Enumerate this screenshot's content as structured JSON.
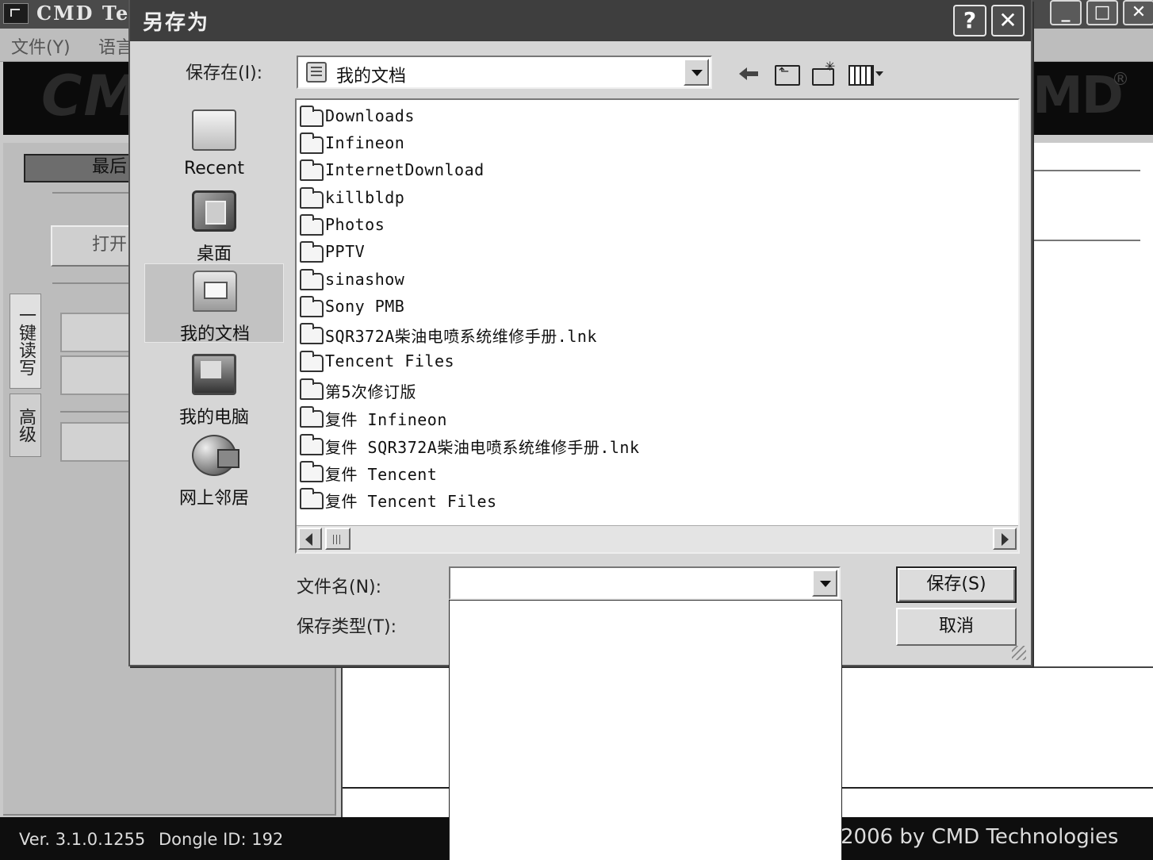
{
  "app": {
    "title": "CMD Tec",
    "menu": [
      "文件(Y)",
      "语言"
    ],
    "banner_logo": "CM",
    "banner_logo_right": "MD",
    "banner_reg": "®",
    "recent_label": "最后",
    "open_label": "打开",
    "side_tabs": [
      "一键读写",
      "高级"
    ],
    "status": {
      "version": "Ver. 3.1.0.1255",
      "dongle": "Dongle ID: 192",
      "copyright": "2006 by CMD Technologies"
    },
    "window_buttons": [
      "_",
      "□",
      "✕"
    ]
  },
  "dialog": {
    "title": "另存为",
    "help_button": "?",
    "close_button": "✕",
    "save_in_label": "保存在(I):",
    "save_in_value": "我的文档",
    "places": [
      {
        "label": "Recent",
        "icon": "recent-icon"
      },
      {
        "label": "桌面",
        "icon": "desktop-icon"
      },
      {
        "label": "我的文档",
        "icon": "my-documents-icon"
      },
      {
        "label": "我的电脑",
        "icon": "my-computer-icon"
      },
      {
        "label": "网上邻居",
        "icon": "network-places-icon"
      }
    ],
    "files": [
      "Downloads",
      "Infineon",
      "InternetDownload",
      "killbldp",
      "Photos",
      "PPTV",
      "sinashow",
      "Sony PMB",
      "SQR372A柴油电喷系统维修手册.lnk",
      "Tencent Files",
      "第5次修订版",
      "复件 Infineon",
      "复件 SQR372A柴油电喷系统维修手册.lnk",
      "复件 Tencent",
      "复件 Tencent Files"
    ],
    "filename_label": "文件名(N):",
    "filename_value": "",
    "filetype_label": "保存类型(T):",
    "save_button": "保存(S)",
    "cancel_button": "取消"
  }
}
